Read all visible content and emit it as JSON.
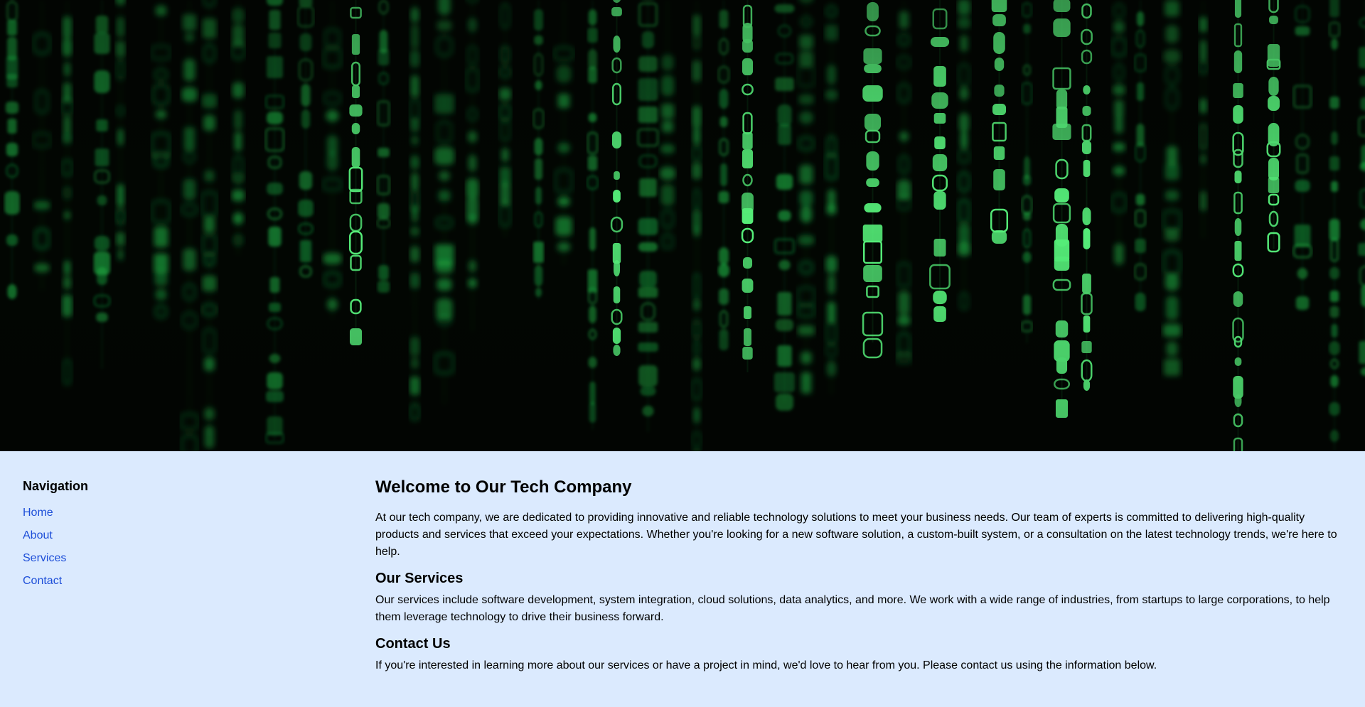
{
  "hero": {
    "image": "matrix-green-code-rain-banner",
    "colors": {
      "background": "#020602",
      "glyph": "#1fbf4a",
      "glyph_bright": "#56f07a"
    }
  },
  "sidebar": {
    "heading": "Navigation",
    "links": [
      {
        "label": "Home"
      },
      {
        "label": "About"
      },
      {
        "label": "Services"
      },
      {
        "label": "Contact"
      }
    ]
  },
  "main": {
    "title": "Welcome to Our Tech Company",
    "intro": "At our tech company, we are dedicated to providing innovative and reliable technology solutions to meet your business needs. Our team of experts is committed to delivering high-quality products and services that exceed your expectations. Whether you're looking for a new software solution, a custom-built system, or a consultation on the latest technology trends, we're here to help.",
    "services_heading": "Our Services",
    "services_text": "Our services include software development, system integration, cloud solutions, data analytics, and more. We work with a wide range of industries, from startups to large corporations, to help them leverage technology to drive their business forward.",
    "contact_heading": "Contact Us",
    "contact_text": "If you're interested in learning more about our services or have a project in mind, we'd love to hear from you. Please contact us using the information below."
  },
  "colors": {
    "page_background": "#dbeafe",
    "link": "#1d4ed8",
    "text": "#000000"
  }
}
